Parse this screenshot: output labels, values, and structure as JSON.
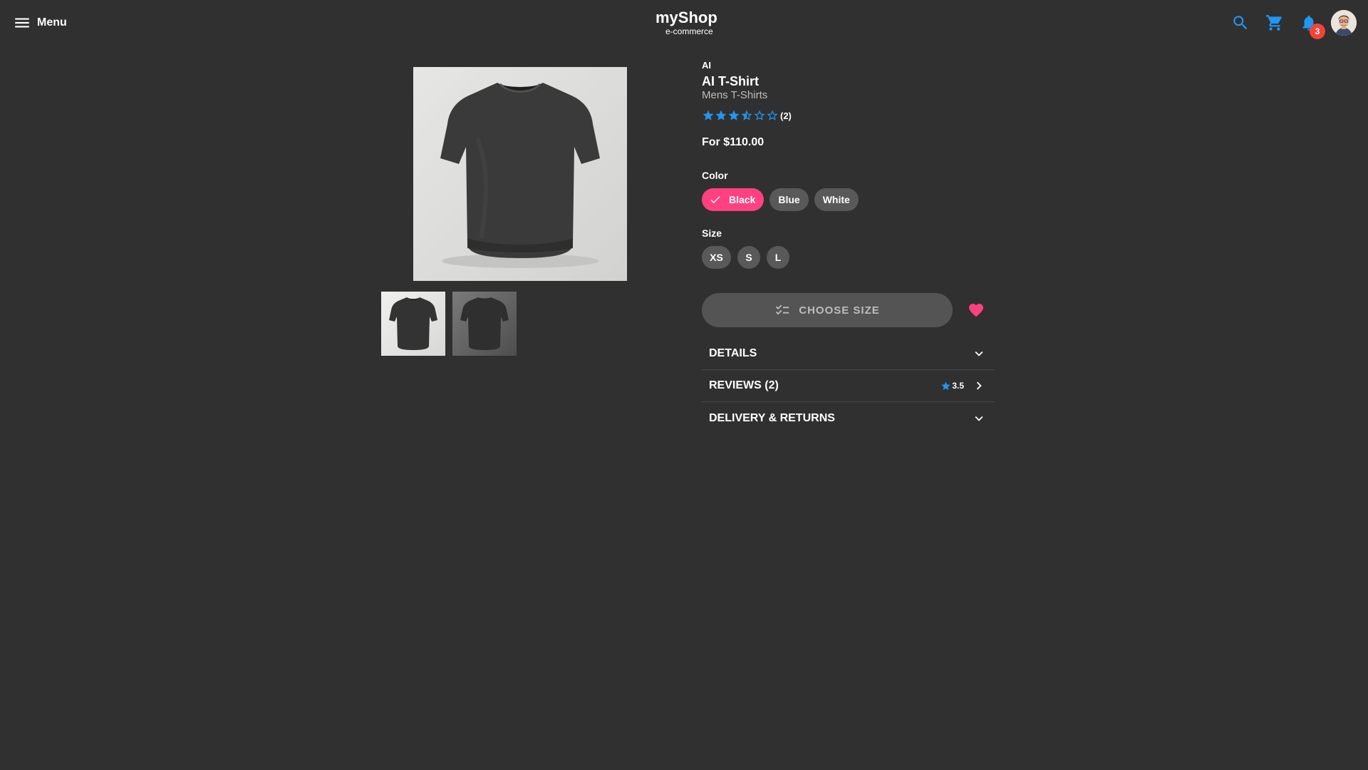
{
  "header": {
    "menu_label": "Menu",
    "brand_name": "myShop",
    "brand_sub": "e-commerce",
    "notification_count": "3",
    "icons": [
      "menu-icon",
      "search-icon",
      "cart-icon",
      "bell-icon",
      "user-avatar"
    ]
  },
  "colors": {
    "background": "#303030",
    "accent_pink": "#ff4081",
    "accent_blue": "#2196f3",
    "chip_gray": "#595959",
    "badge_red": "#f44336"
  },
  "product": {
    "brand": "AI",
    "title": "AI T-Shirt",
    "category": "Mens T-Shirts",
    "rating": 3.5,
    "rating_max": 5,
    "rating_count": "(2)",
    "price": "For $110.00",
    "color_label": "Color",
    "colors": [
      "Black",
      "Blue",
      "White"
    ],
    "selected_color": "Black",
    "size_label": "Size",
    "sizes": [
      "XS",
      "S",
      "L"
    ],
    "choose_size_label": "CHOOSE SIZE",
    "thumbnails": [
      "front-view",
      "back-view"
    ]
  },
  "accordion": {
    "details_label": "DETAILS",
    "reviews_label": "REVIEWS (2)",
    "reviews_rating": "3.5",
    "delivery_label": "DELIVERY & RETURNS"
  }
}
